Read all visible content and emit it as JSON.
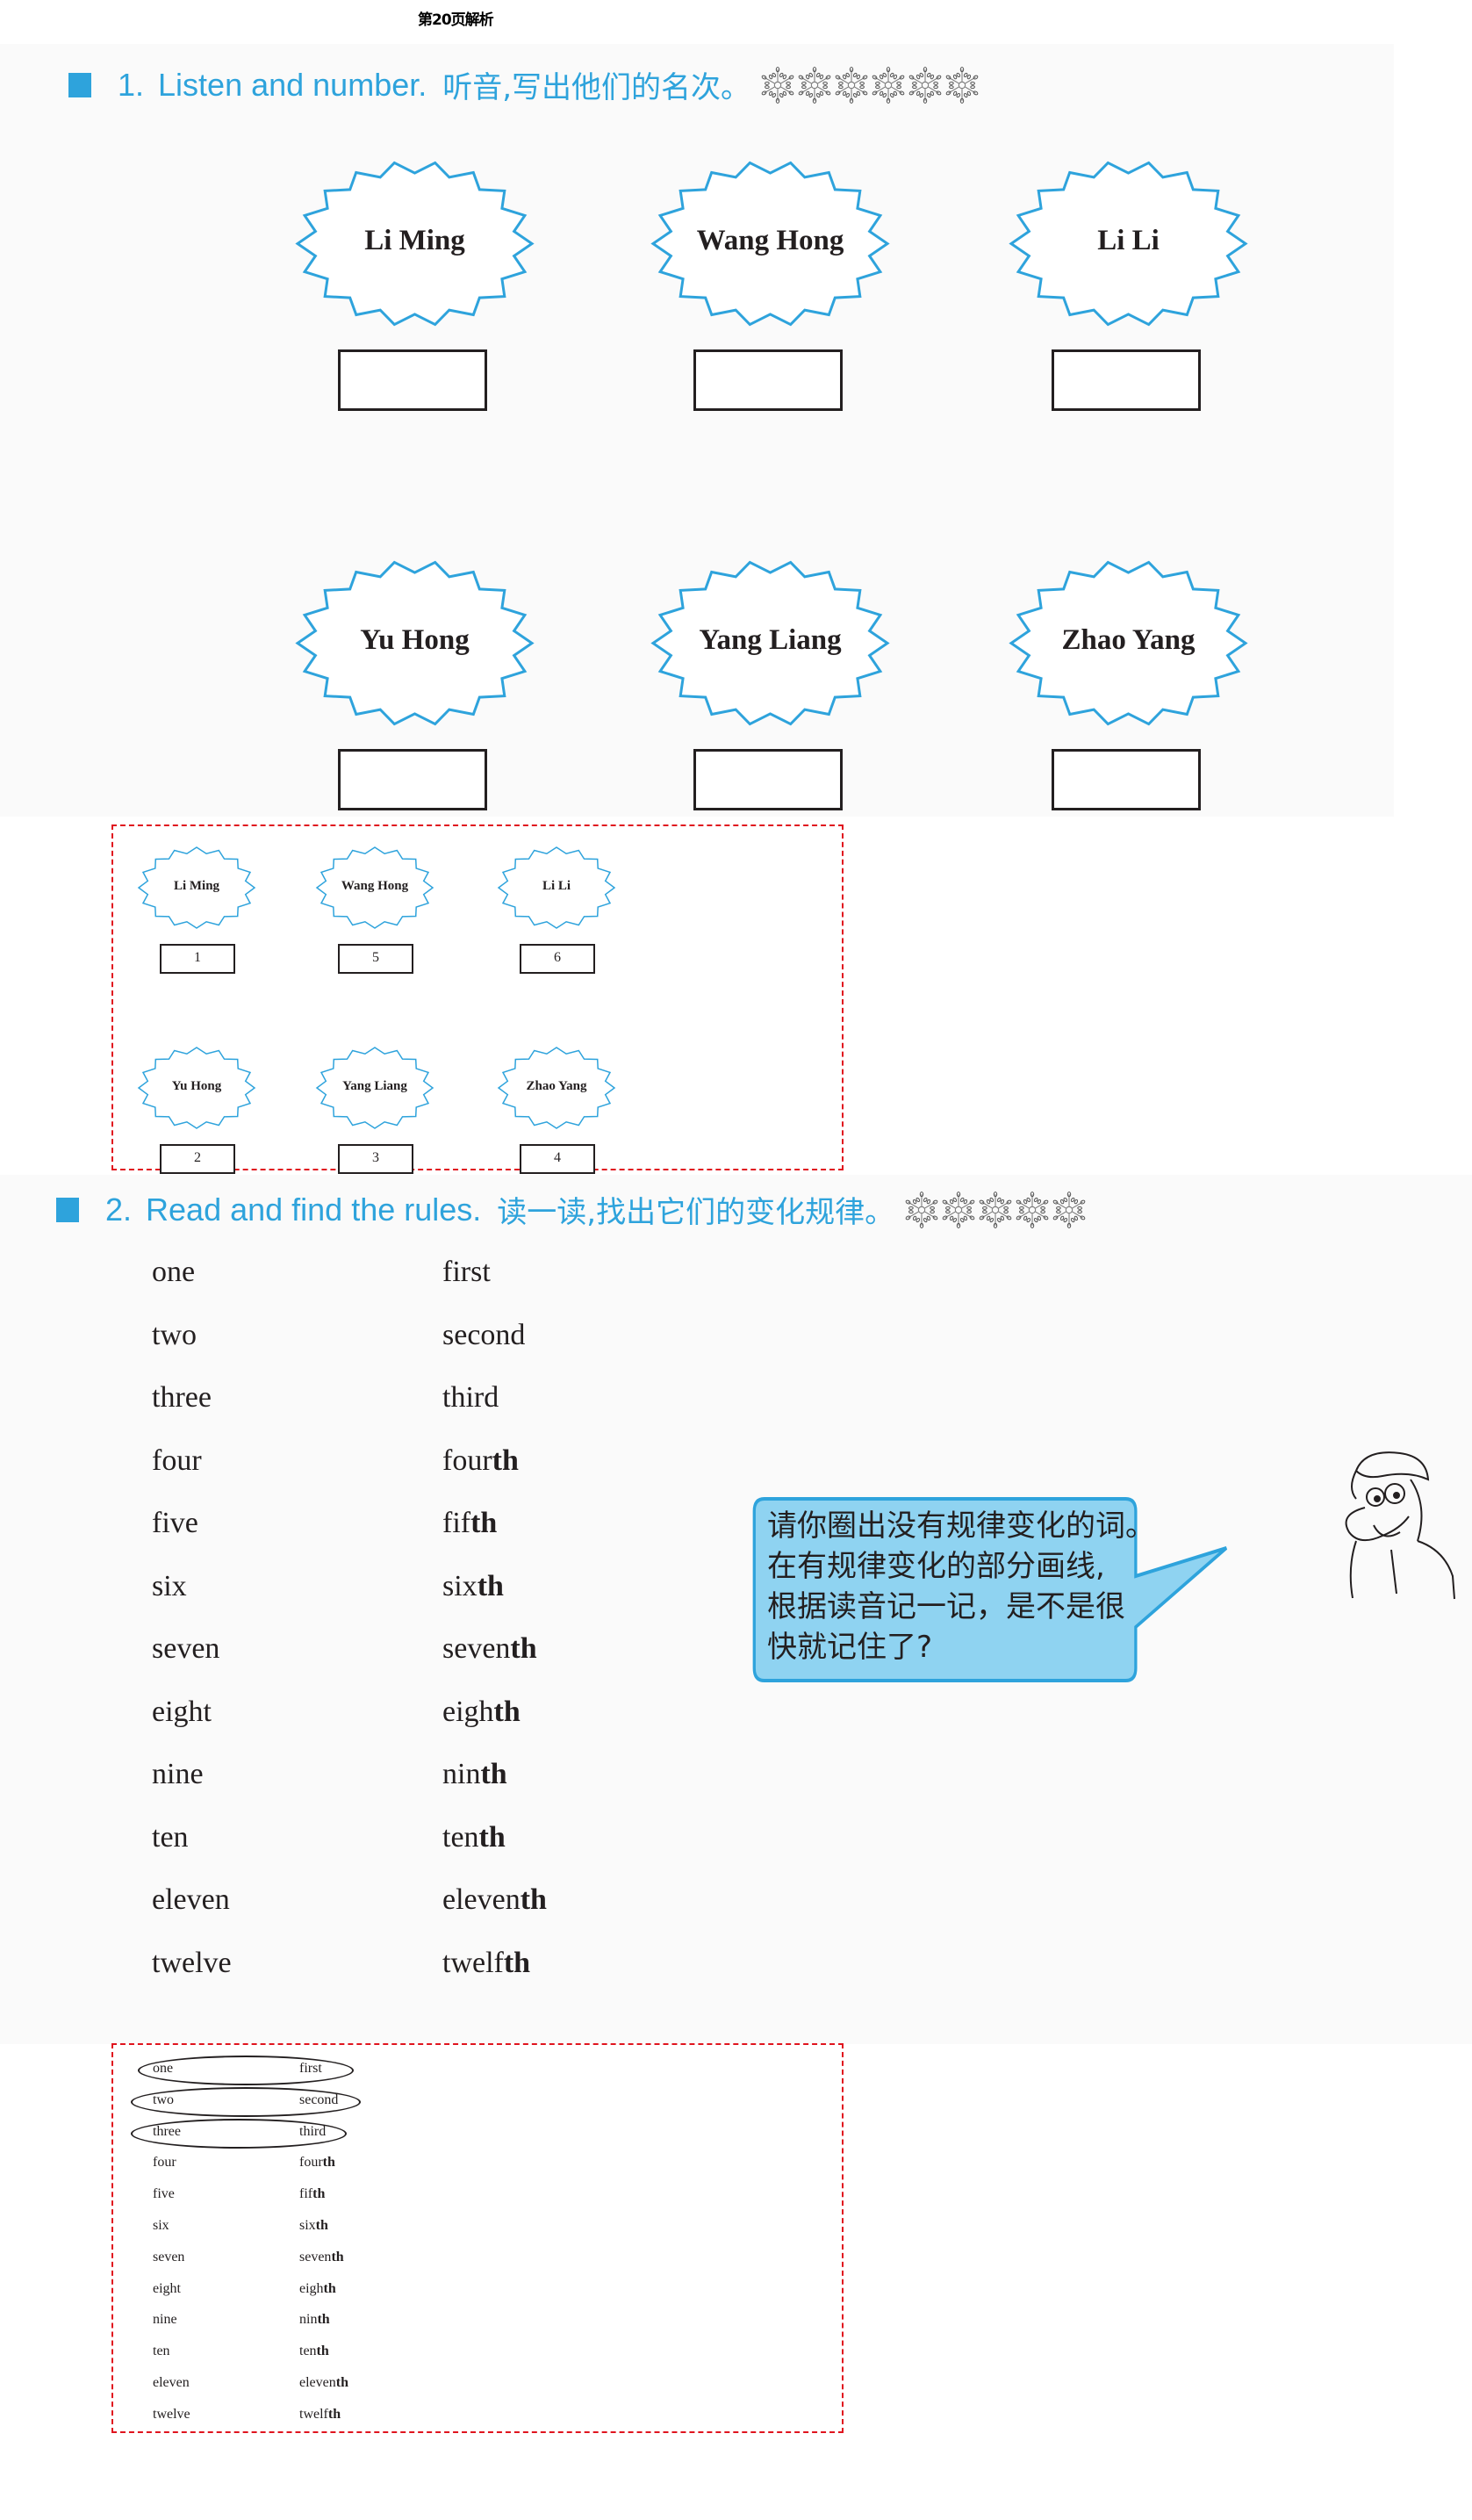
{
  "header": {
    "title": "第20页解析"
  },
  "colors": {
    "accent_blue": "#2ea3dc",
    "answer_border": "#e0141e",
    "ink": "#231f20"
  },
  "section1": {
    "number": "1.",
    "title_en": "Listen and number.",
    "title_zh": "听音,写出他们的名次。",
    "decoration_icon": "snowflake-icon",
    "decoration_count": 6,
    "names": [
      {
        "name": "Li Ming",
        "answer": ""
      },
      {
        "name": "Wang Hong",
        "answer": ""
      },
      {
        "name": "Li Li",
        "answer": ""
      },
      {
        "name": "Yu Hong",
        "answer": ""
      },
      {
        "name": "Yang Liang",
        "answer": ""
      },
      {
        "name": "Zhao Yang",
        "answer": ""
      }
    ],
    "answers": [
      {
        "name": "Li Ming",
        "rank": "1"
      },
      {
        "name": "Wang Hong",
        "rank": "5"
      },
      {
        "name": "Li Li",
        "rank": "6"
      },
      {
        "name": "Yu Hong",
        "rank": "2"
      },
      {
        "name": "Yang Liang",
        "rank": "3"
      },
      {
        "name": "Zhao Yang",
        "rank": "4"
      }
    ]
  },
  "section2": {
    "number": "2.",
    "title_en": "Read and find the rules.",
    "title_zh": "读一读,找出它们的变化规律。",
    "decoration_icon": "snowflake-icon",
    "decoration_count": 5,
    "pairs": [
      {
        "cardinal": "one",
        "ordinal_stem": "first",
        "ordinal_suffix": "",
        "irregular": true
      },
      {
        "cardinal": "two",
        "ordinal_stem": "second",
        "ordinal_suffix": "",
        "irregular": true
      },
      {
        "cardinal": "three",
        "ordinal_stem": "third",
        "ordinal_suffix": "",
        "irregular": true
      },
      {
        "cardinal": "four",
        "ordinal_stem": "four",
        "ordinal_suffix": "th",
        "irregular": false
      },
      {
        "cardinal": "five",
        "ordinal_stem": "fif",
        "ordinal_suffix": "th",
        "irregular": false
      },
      {
        "cardinal": "six",
        "ordinal_stem": "six",
        "ordinal_suffix": "th",
        "irregular": false
      },
      {
        "cardinal": "seven",
        "ordinal_stem": "seven",
        "ordinal_suffix": "th",
        "irregular": false
      },
      {
        "cardinal": "eight",
        "ordinal_stem": "eigh",
        "ordinal_suffix": "th",
        "irregular": false
      },
      {
        "cardinal": "nine",
        "ordinal_stem": "nin",
        "ordinal_suffix": "th",
        "irregular": false
      },
      {
        "cardinal": "ten",
        "ordinal_stem": "ten",
        "ordinal_suffix": "th",
        "irregular": false
      },
      {
        "cardinal": "eleven",
        "ordinal_stem": "eleven",
        "ordinal_suffix": "th",
        "irregular": false
      },
      {
        "cardinal": "twelve",
        "ordinal_stem": "twelf",
        "ordinal_suffix": "th",
        "irregular": false
      }
    ],
    "bubble_lines": [
      "请你圈出没有规律变化的词。",
      "在有规律变化的部分画线,",
      "根据读音记一记，是不是很",
      "快就记住了?"
    ]
  }
}
